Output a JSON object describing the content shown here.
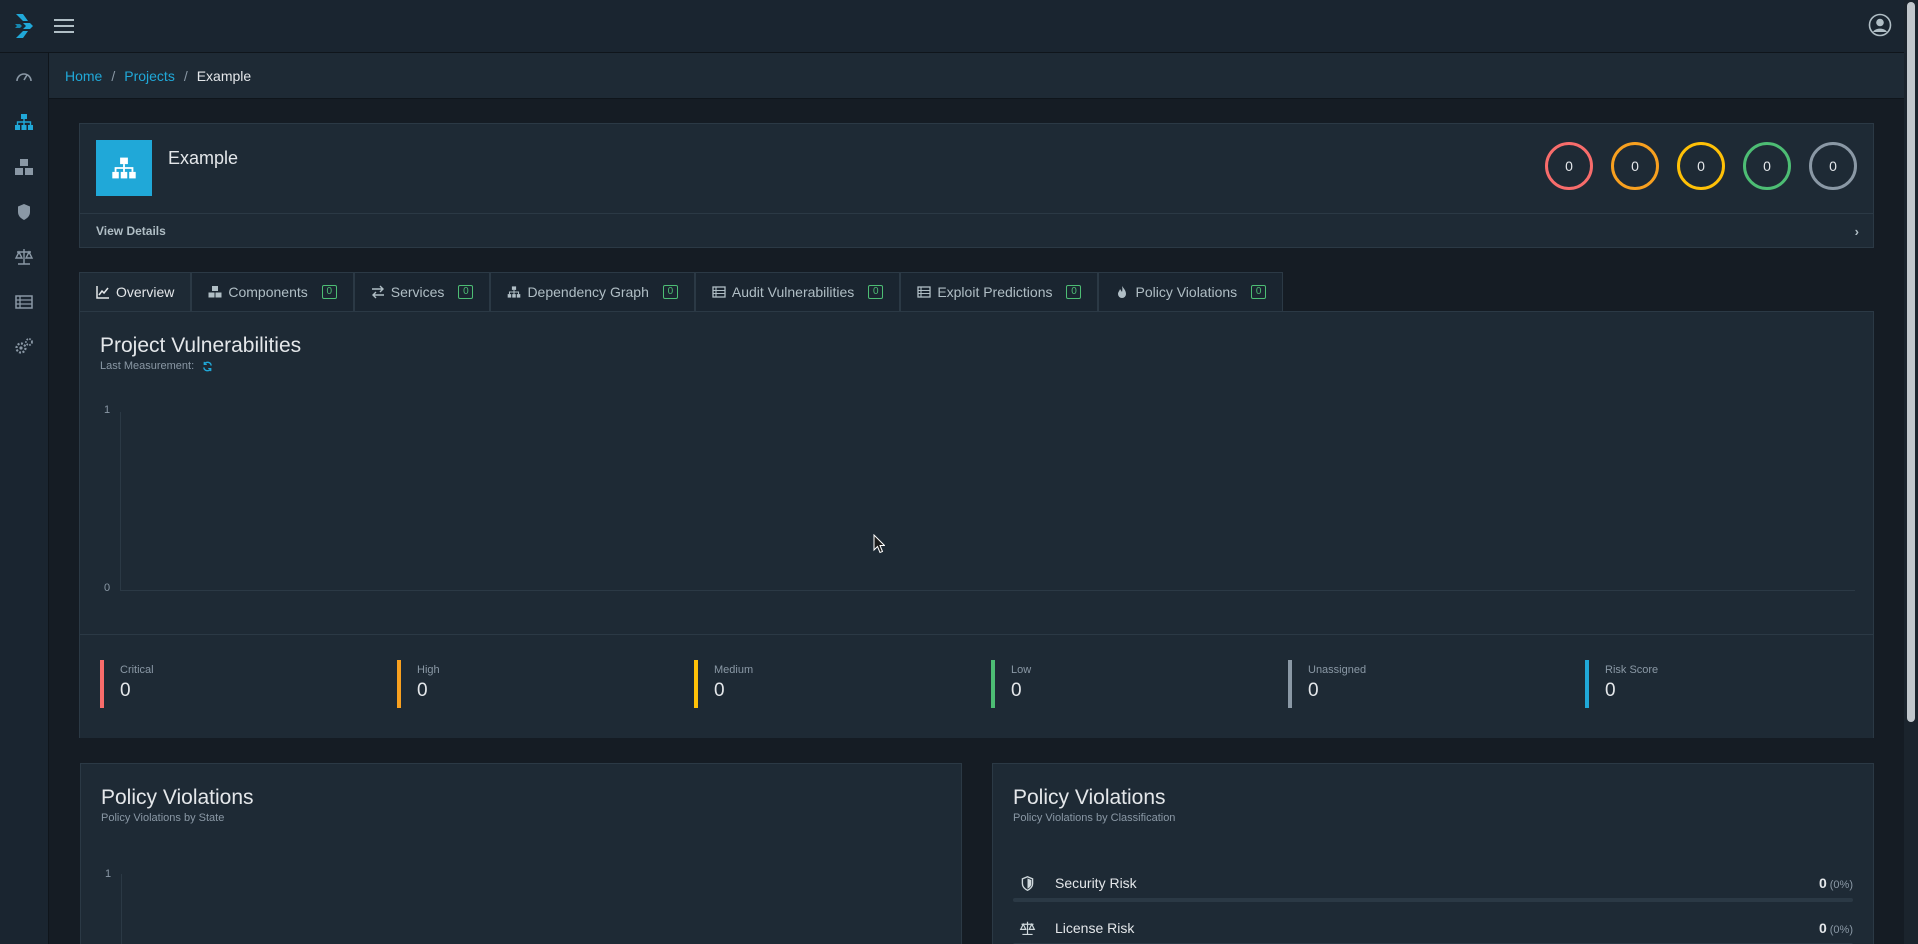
{
  "breadcrumb": {
    "home": "Home",
    "projects": "Projects",
    "current": "Example"
  },
  "project": {
    "name": "Example",
    "view_details": "View Details",
    "severity_counts": [
      {
        "value": "0",
        "color": "#f86c6b"
      },
      {
        "value": "0",
        "color": "#f8a01f"
      },
      {
        "value": "0",
        "color": "#ffc107"
      },
      {
        "value": "0",
        "color": "#4dbd74"
      },
      {
        "value": "0",
        "color": "#8a98a5"
      }
    ]
  },
  "tabs": [
    {
      "label": "Overview",
      "icon": "line-chart-icon",
      "badge": null
    },
    {
      "label": "Components",
      "icon": "cubes-icon",
      "badge": "0"
    },
    {
      "label": "Services",
      "icon": "exchange-icon",
      "badge": "0"
    },
    {
      "label": "Dependency Graph",
      "icon": "sitemap-icon",
      "badge": "0"
    },
    {
      "label": "Audit Vulnerabilities",
      "icon": "tasks-icon",
      "badge": "0"
    },
    {
      "label": "Exploit Predictions",
      "icon": "tasks-icon",
      "badge": "0"
    },
    {
      "label": "Policy Violations",
      "icon": "fire-icon",
      "badge": "0"
    }
  ],
  "overview": {
    "title": "Project Vulnerabilities",
    "last_measurement_label": "Last Measurement:",
    "chart_data": {
      "type": "line",
      "ylim": [
        0,
        1
      ],
      "y_ticks": [
        "1",
        "0"
      ],
      "series": []
    }
  },
  "stats": [
    {
      "label": "Critical",
      "value": "0",
      "color": "#f86c6b"
    },
    {
      "label": "High",
      "value": "0",
      "color": "#f8a01f"
    },
    {
      "label": "Medium",
      "value": "0",
      "color": "#ffc107"
    },
    {
      "label": "Low",
      "value": "0",
      "color": "#4dbd74"
    },
    {
      "label": "Unassigned",
      "value": "0",
      "color": "#8a98a5"
    },
    {
      "label": "Risk Score",
      "value": "0",
      "color": "#20a8d8"
    }
  ],
  "policy_state": {
    "title": "Policy Violations",
    "subtitle": "Policy Violations by State",
    "y_tick": "1"
  },
  "policy_classification": {
    "title": "Policy Violations",
    "subtitle": "Policy Violations by Classification",
    "rows": [
      {
        "label": "Security Risk",
        "count": "0",
        "pct": "(0%)",
        "fraction": 0,
        "icon": "shield-icon"
      },
      {
        "label": "License Risk",
        "count": "0",
        "pct": "(0%)",
        "fraction": 0,
        "icon": "balance-scale-icon"
      }
    ]
  }
}
